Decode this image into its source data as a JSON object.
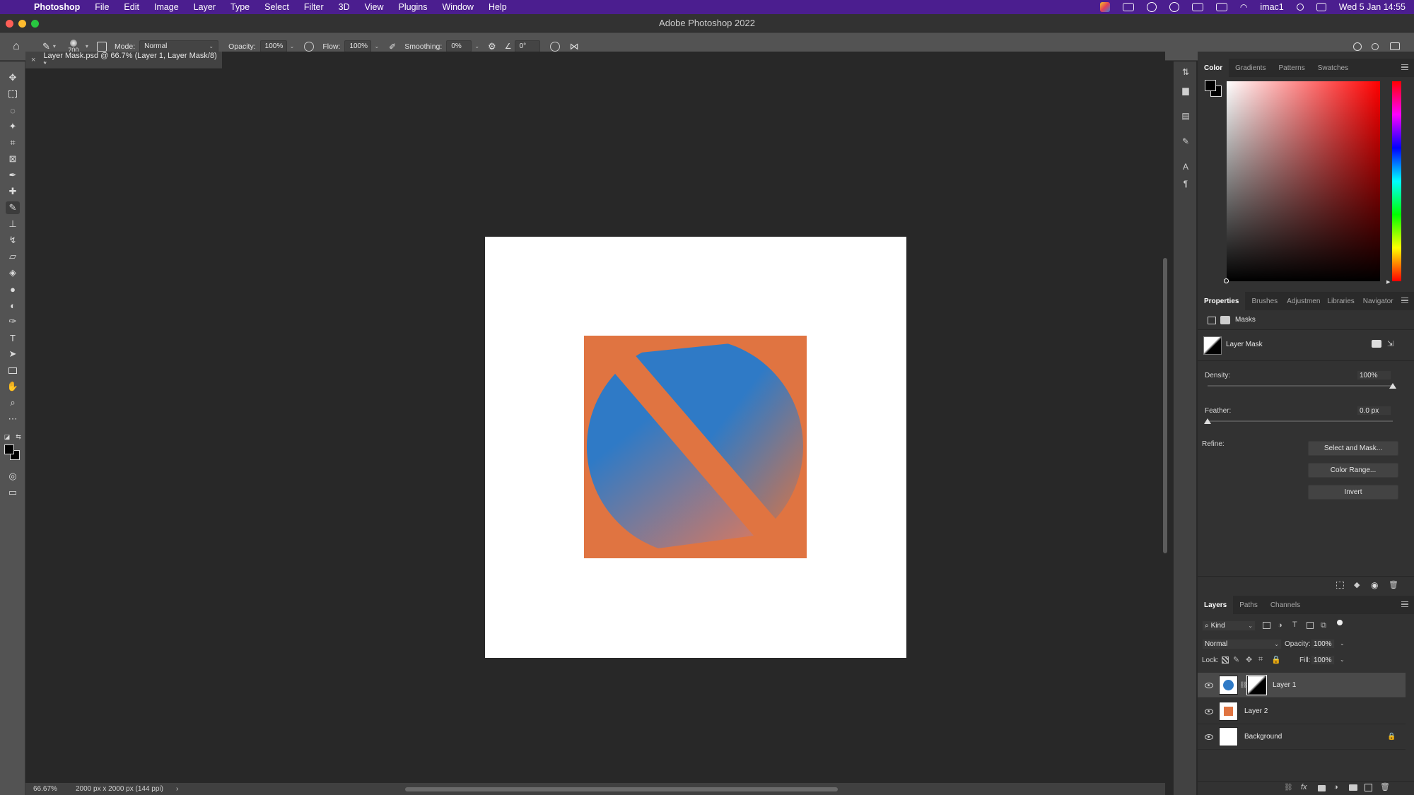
{
  "menubar": {
    "app_name": "Photoshop",
    "items": [
      "File",
      "Edit",
      "Image",
      "Layer",
      "Type",
      "Select",
      "Filter",
      "3D",
      "View",
      "Plugins",
      "Window",
      "Help"
    ],
    "user": "imac1",
    "datetime": "Wed 5 Jan 14:55"
  },
  "window": {
    "title": "Adobe Photoshop 2022"
  },
  "options": {
    "brush_size": "700",
    "mode_label": "Mode:",
    "mode_value": "Normal",
    "opacity_label": "Opacity:",
    "opacity_value": "100%",
    "flow_label": "Flow:",
    "flow_value": "100%",
    "smoothing_label": "Smoothing:",
    "smoothing_value": "0%",
    "angle_value": "0°"
  },
  "document": {
    "tab_title": "Layer Mask.psd @ 66.7% (Layer 1, Layer Mask/8) *",
    "zoom": "66.67%",
    "info": "2000 px x 2000 px (144 ppi)"
  },
  "art": {
    "background_color": "#ffffff",
    "square_color": "#e07441",
    "circle_color": "#2f7ac6"
  },
  "color_panel": {
    "tabs": [
      "Color",
      "Gradients",
      "Patterns",
      "Swatches"
    ],
    "active_tab": "Color"
  },
  "properties_panel": {
    "tabs": [
      "Properties",
      "Brushes",
      "Adjustmen",
      "Libraries",
      "Navigator"
    ],
    "section_title": "Masks",
    "mask_name": "Layer Mask",
    "density_label": "Density:",
    "density_value": "100%",
    "density_fraction": 1.0,
    "feather_label": "Feather:",
    "feather_value": "0.0 px",
    "feather_fraction": 0.0,
    "refine_label": "Refine:",
    "buttons": [
      "Select and Mask...",
      "Color Range...",
      "Invert"
    ]
  },
  "layers_panel": {
    "tabs": [
      "Layers",
      "Paths",
      "Channels"
    ],
    "filter_kind": "Kind",
    "blend_mode": "Normal",
    "opacity_label": "Opacity:",
    "opacity_value": "100%",
    "lock_label": "Lock:",
    "fill_label": "Fill:",
    "fill_value": "100%",
    "layers": [
      {
        "name": "Layer 1",
        "selected": true
      },
      {
        "name": "Layer 2",
        "selected": false
      },
      {
        "name": "Background",
        "selected": false,
        "locked": true
      }
    ]
  }
}
